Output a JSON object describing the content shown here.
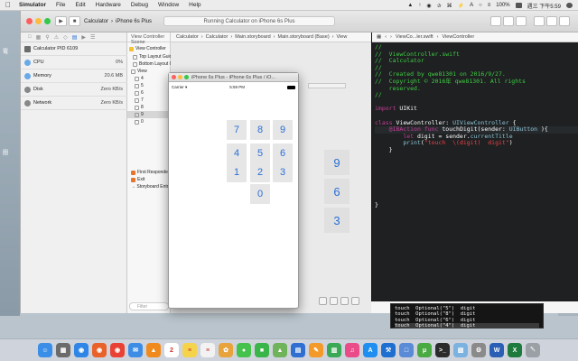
{
  "menubar": {
    "app_name": "Simulator",
    "items": [
      "File",
      "Edit",
      "Hardware",
      "Debug",
      "Window",
      "Help"
    ],
    "battery": "100%",
    "clock": "週三 下午5:59",
    "status_glyphs": [
      "▲",
      "↑",
      "◉",
      "✰",
      "⌘",
      "⚡",
      "A",
      "○",
      "≡"
    ]
  },
  "desktop": {
    "left_labels": [
      "電",
      "圖"
    ]
  },
  "xcode": {
    "scheme_app": "Calculator",
    "scheme_device": "iPhone 6s Plus",
    "status_text": "Running Calculator on iPhone 6s Plus",
    "debug_nav": {
      "process": "Calculator PID 6109",
      "gauges": [
        {
          "name": "CPU",
          "value": "0%"
        },
        {
          "name": "Memory",
          "value": "20.6 MB"
        },
        {
          "name": "Disk",
          "value": "Zero KB/s"
        },
        {
          "name": "Network",
          "value": "Zero KB/s"
        }
      ]
    },
    "ib_jump_bar": [
      "Calculator",
      "Calculator",
      "Main.storyboard",
      "Main.storyboard (Base)",
      "View"
    ],
    "outline": {
      "header": "View Controller Scene",
      "rows": [
        "View Controller",
        "Top Layout Guide",
        "Bottom Layout Guide",
        "View",
        "4",
        "5",
        "6",
        "7",
        "8",
        "9",
        "0",
        "First Responder",
        "Exit",
        "Storyboard Entry Point"
      ],
      "filter_placeholder": "Filter"
    },
    "ib_keys": [
      "9",
      "6",
      "3"
    ],
    "editor_jump_bar": [
      "ViewCo...ler.swift",
      "ViewController"
    ],
    "code_lines": [
      [
        {
          "t": "//",
          "c": "com"
        }
      ],
      [
        {
          "t": "//  ViewController.swift",
          "c": "com"
        }
      ],
      [
        {
          "t": "//  Calculator",
          "c": "com"
        }
      ],
      [
        {
          "t": "//",
          "c": "com"
        }
      ],
      [
        {
          "t": "//  Created by qwe81301 on 2016/9/27.",
          "c": "com"
        }
      ],
      [
        {
          "t": "//  Copyright © 2016年 qwe81301. All rights",
          "c": "com"
        }
      ],
      [
        {
          "t": "    reserved.",
          "c": "com"
        }
      ],
      [
        {
          "t": "//",
          "c": "com"
        }
      ],
      [
        {
          "t": "",
          "c": "plain"
        }
      ],
      [
        {
          "t": "import",
          "c": "kw"
        },
        {
          "t": " UIKit",
          "c": "txt"
        }
      ],
      [
        {
          "t": "",
          "c": "plain"
        }
      ],
      [
        {
          "t": "class",
          "c": "kw"
        },
        {
          "t": " ViewController: ",
          "c": "txt"
        },
        {
          "t": "UIViewController",
          "c": "ty"
        },
        {
          "t": " {",
          "c": "txt"
        }
      ],
      [
        {
          "t": "    ",
          "c": "txt"
        },
        {
          "t": "@IBAction",
          "c": "kw"
        },
        {
          "t": " ",
          "c": "txt"
        },
        {
          "t": "func",
          "c": "kw"
        },
        {
          "t": " touchDigit(sender: ",
          "c": "txt"
        },
        {
          "t": "UIButton",
          "c": "ty"
        },
        {
          "t": " ){",
          "c": "txt"
        }
      ],
      [
        {
          "t": "        ",
          "c": "txt"
        },
        {
          "t": "let",
          "c": "kw"
        },
        {
          "t": " digit = sender.",
          "c": "txt"
        },
        {
          "t": "currentTitle",
          "c": "ty"
        }
      ],
      [
        {
          "t": "        ",
          "c": "txt"
        },
        {
          "t": "print",
          "c": "ty"
        },
        {
          "t": "(",
          "c": "txt"
        },
        {
          "t": "\"touch  \\(digit)  digit\"",
          "c": "str"
        },
        {
          "t": ")",
          "c": "txt"
        }
      ],
      [
        {
          "t": "    }",
          "c": "txt"
        }
      ],
      [
        {
          "t": "",
          "c": "plain"
        }
      ],
      [
        {
          "t": "",
          "c": "plain"
        }
      ],
      [
        {
          "t": "",
          "c": "plain"
        }
      ],
      [
        {
          "t": "",
          "c": "plain"
        }
      ],
      [
        {
          "t": "",
          "c": "plain"
        }
      ],
      [
        {
          "t": "",
          "c": "plain"
        }
      ],
      [
        {
          "t": "",
          "c": "plain"
        }
      ],
      [
        {
          "t": "}",
          "c": "txt"
        }
      ]
    ]
  },
  "simulator": {
    "title": "iPhone 6s Plus - iPhone 6s Plus / iO...",
    "carrier": "Carrier ▾",
    "time": "5:59 PM",
    "keys": [
      "7",
      "8",
      "9",
      "4",
      "5",
      "6",
      "1",
      "2",
      "3",
      "0"
    ]
  },
  "console": {
    "lines": [
      "touch  Optional(\"5\")  digit",
      "touch  Optional(\"8\")  digit",
      "touch  Optional(\"6\")  digit",
      "touch  Optional(\"4\")  digit"
    ]
  },
  "dock": {
    "apps": [
      "Finder",
      "Launchpad",
      "Safari",
      "Firefox",
      "Chrome",
      "Mail",
      "VLC",
      "Calendar",
      "Notes",
      "Reminders",
      "Photos",
      "Messages",
      "FaceTime",
      "Maps",
      "Keynote",
      "Pages",
      "Numbers",
      "iTunes",
      "App Store",
      "Xcode",
      "Simulator",
      "uTorrent",
      "Terminal",
      "Preview",
      "System Preferences",
      "Word",
      "Excel",
      "Trash"
    ],
    "colors": [
      "#3b8ee8",
      "#6b6b6b",
      "#2f86e6",
      "#e8622a",
      "#e94235",
      "#3d8de6",
      "#f08a1c",
      "#ffffff",
      "#f5d34a",
      "#f2f2f2",
      "#e8a33d",
      "#45c24c",
      "#3ab54a",
      "#6fb35a",
      "#2e6fd1",
      "#f39a2b",
      "#3aa956",
      "#e94c89",
      "#1e8ef0",
      "#1e6fd0",
      "#5a8bd6",
      "#4aaa42",
      "#2b2b2b",
      "#7bb2e0",
      "#8a8a8a",
      "#2b5fb5",
      "#1f7a3e",
      "#9aa0a6"
    ],
    "glyphs": [
      "☺",
      "▦",
      "◉",
      "◉",
      "◉",
      "✉",
      "▲",
      "2",
      "≡",
      "≡",
      "✿",
      "●",
      "■",
      "▲",
      "▤",
      "✎",
      "▥",
      "♫",
      "A",
      "⚒",
      "□",
      "μ",
      ">_",
      "▧",
      "⚙",
      "W",
      "X",
      "␡"
    ]
  }
}
